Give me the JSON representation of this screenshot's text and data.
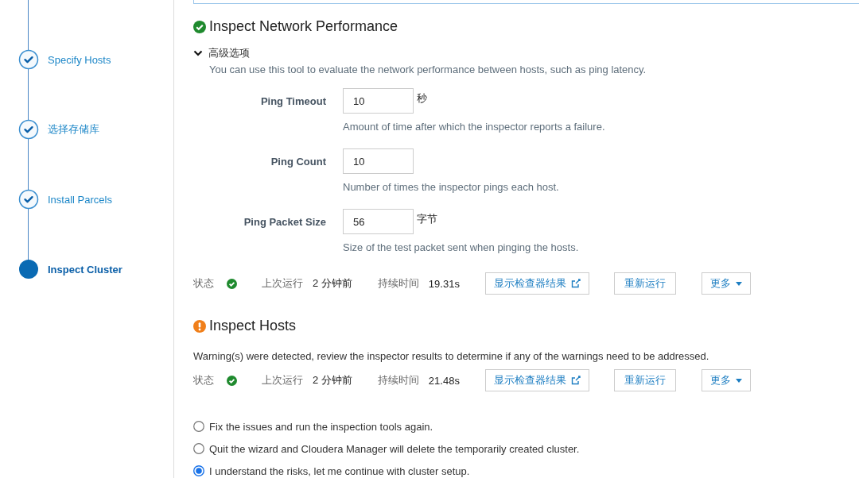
{
  "steps": [
    {
      "label": "Specify Hosts",
      "kind": "done"
    },
    {
      "label": "选择存储库",
      "kind": "done"
    },
    {
      "label": "Install Parcels",
      "kind": "done"
    },
    {
      "label": "Inspect Cluster",
      "kind": "current"
    }
  ],
  "sections": [
    {
      "title": "Inspect Network Performance",
      "kind": "success",
      "advanced": {
        "label": "高级选项",
        "expanded": true,
        "description": "You can use this tool to evaluate the network performance between hosts, such as ping latency.",
        "fields": [
          {
            "label": "Ping Timeout",
            "value": "10",
            "unit": "秒",
            "help": "Amount of time after which the inspector reports a failure."
          },
          {
            "label": "Ping Count",
            "value": "10",
            "help": "Number of times the inspector pings each host."
          },
          {
            "label": "Ping Packet Size",
            "value": "56",
            "unit": "字节",
            "help": "Size of the test packet sent when pinging the hosts."
          }
        ]
      },
      "status_row": {
        "status_label": "状态",
        "status_ok": true,
        "last_run_label": "上次运行",
        "last_run": "2 分钟前",
        "duration_label": "持续时间",
        "duration": "19.31s",
        "buttons": [
          "显示检查器结果",
          "重新运行",
          "更多"
        ]
      }
    },
    {
      "title": "Inspect Hosts",
      "kind": "warning",
      "message": "Warning(s) were detected, review the inspector results to determine if any of the warnings need to be addressed.",
      "status_row": {
        "status_label": "状态",
        "status_ok": true,
        "last_run_label": "上次运行",
        "last_run": "2 分钟前",
        "duration_label": "持续时间",
        "duration": "21.48s",
        "buttons": [
          "显示检查器结果",
          "重新运行",
          "更多"
        ]
      }
    }
  ],
  "options": [
    {
      "label": "Fix the issues and run the inspection tools again.",
      "selected": false
    },
    {
      "label": "Quit the wizard and Cloudera Manager will delete the temporarily created cluster.",
      "selected": false
    },
    {
      "label": "I understand the risks, let me continue with cluster setup.",
      "selected": true
    }
  ]
}
